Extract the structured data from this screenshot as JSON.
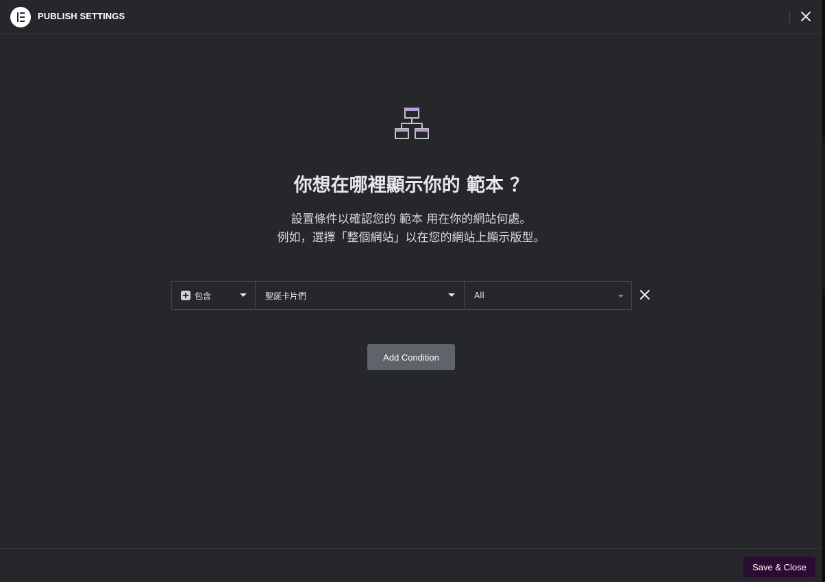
{
  "header": {
    "title": "PUBLISH SETTINGS",
    "logo_icon": "elementor-logo-icon",
    "close_icon": "close-icon"
  },
  "main": {
    "icon": "sitemap-icon",
    "heading": "你想在哪裡顯示你的 範本 ？",
    "description_line1": "設置條件以確認您的 範本 用在你的網站何處。",
    "description_line2": "例如，選擇「整個網站」以在您的網站上顯示版型。"
  },
  "condition": {
    "type_label": "包含",
    "type_icon": "plus-square-icon",
    "name_value": "聖誕卡片們",
    "sub_value": "All",
    "delete_icon": "close-icon"
  },
  "actions": {
    "add_condition_label": "Add Condition",
    "save_close_label": "Save & Close"
  },
  "colors": {
    "background": "#26272b",
    "accent_purple": "#b899d6",
    "save_button": "#2b0a33",
    "add_button": "#5f636a"
  }
}
